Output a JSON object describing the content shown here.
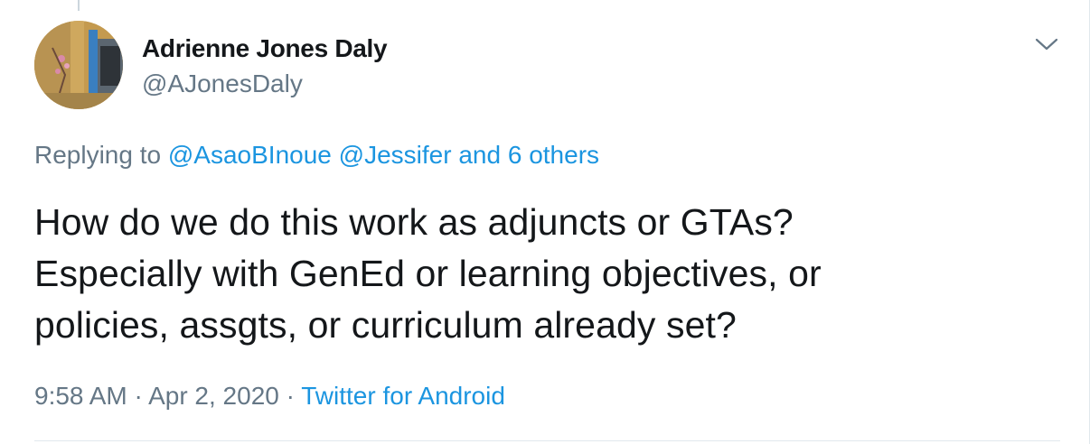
{
  "tweet": {
    "author": {
      "display_name": "Adrienne Jones Daly",
      "handle": "@AJonesDaly",
      "avatar_icon": "profile-photo"
    },
    "menu_icon": "chevron-down-icon",
    "replying": {
      "prefix": "Replying to",
      "mention_1": "@AsaoBInoue",
      "mention_2": "@Jessifer",
      "others": "and 6 others"
    },
    "body_lines": [
      "How do we do this work as adjuncts or GTAs?",
      "Especially with GenEd or learning objectives, or",
      "policies, assgts, or curriculum already set?"
    ],
    "time": "9:58 AM",
    "separator": "·",
    "date": "Apr 2, 2020",
    "source": "Twitter for Android",
    "colors": {
      "link": "#1b95e0",
      "secondary": "#657786",
      "text": "#14171a",
      "border": "#e1e8ed"
    }
  }
}
